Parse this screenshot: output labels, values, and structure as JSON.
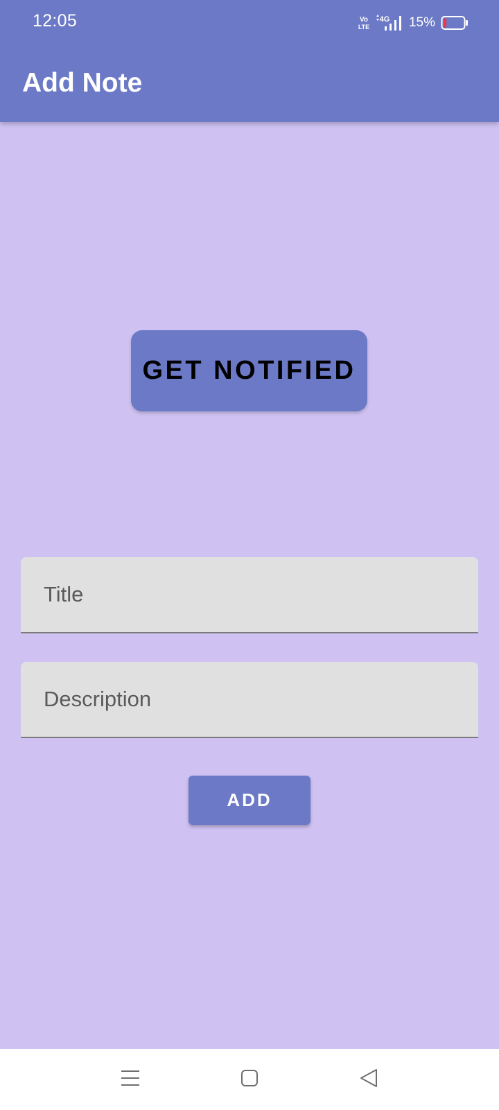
{
  "status_bar": {
    "time": "12:05",
    "volte": "Vo LTE",
    "network": "4G",
    "battery_percent": "15%",
    "battery_level": 0.15,
    "battery_color": "#e53950"
  },
  "app_bar": {
    "title": "Add Note"
  },
  "notify_button": {
    "label": "GET NOTIFIED"
  },
  "form": {
    "title_placeholder": "Title",
    "title_value": "",
    "description_placeholder": "Description",
    "description_value": "",
    "add_label": "ADD"
  },
  "nav_bar": {
    "menu_icon": "menu-icon",
    "home_icon": "home-icon",
    "back_icon": "back-icon"
  },
  "colors": {
    "primary": "#6b79c6",
    "background": "#cfc2f3",
    "field": "#e0e0e0"
  }
}
